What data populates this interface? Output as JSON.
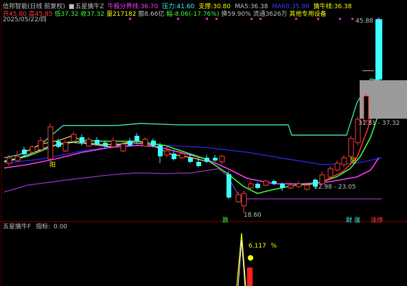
{
  "header": {
    "app": "信邦智能(日线 前复权)",
    "indicator": "五星擒牛Z",
    "items": [
      {
        "label": "牛股分界线:",
        "value": "36.70",
        "color": "#ff3cff"
      },
      {
        "label": "压力:",
        "value": "41.60",
        "color": "#3cffff"
      },
      {
        "label": "支撑:",
        "value": "30.80",
        "color": "#ffff00"
      },
      {
        "label": "MA5:",
        "value": "36.38",
        "color": "#c0c0c0"
      },
      {
        "label": "MA60:",
        "value": "35.98",
        "color": "#3c3cff"
      },
      {
        "label": "擒牛线:",
        "value": "36.38",
        "color": "#ffff00"
      }
    ]
  },
  "stats": {
    "items": [
      {
        "label": "开",
        "value": "45.80",
        "color": "#ff3c3c"
      },
      {
        "label": "高",
        "value": "45.85",
        "color": "#ff3c3c"
      },
      {
        "label": "低",
        "value": "37.32",
        "color": "#3cff3c"
      },
      {
        "label": "收",
        "value": "37.32",
        "color": "#3cff3c"
      },
      {
        "label": "量",
        "value": "217182",
        "color": "#ffff00"
      },
      {
        "label": "额",
        "value": "8.66亿",
        "color": "#c0c0c0"
      },
      {
        "label": "幅",
        "value": "-8.06(-17.76%)",
        "color": "#3cff3c"
      },
      {
        "label": "换",
        "value": "59.90%",
        "color": "#c0c0c0"
      },
      {
        "label": "流通",
        "value": "3626万",
        "color": "#c0c0c0"
      },
      {
        "label": "",
        "value": "其他专用设备",
        "color": "#ffff00"
      }
    ]
  },
  "date": {
    "value": "2025/05/22/四"
  },
  "price_labels": {
    "high": "45.88",
    "box_range": "31.81 - 37.32",
    "low_range": "22.98 - 23.05",
    "low": "18.60"
  },
  "markers": {
    "yang_a": "阳",
    "yang_b": "阳",
    "die": "跌",
    "cai": "财",
    "zhang": "涨",
    "zhangting": "涨停"
  },
  "sub_panel": {
    "title": "五星擒牛F",
    "index_label": "指标:",
    "index_value": "0.00",
    "pct": "6.117",
    "pct_unit": "%"
  },
  "colors": {
    "up": "#ff3c3c",
    "down": "#3cffff",
    "ma_green": "#3cff3c",
    "ma_blue": "#3c3cff",
    "ma_magenta": "#ff3cff",
    "ma_purple": "#8a2be2",
    "support_line": "#40e0b0",
    "box_gray": "#9a9a9a",
    "bar_yellow": "#ffff00"
  }
}
